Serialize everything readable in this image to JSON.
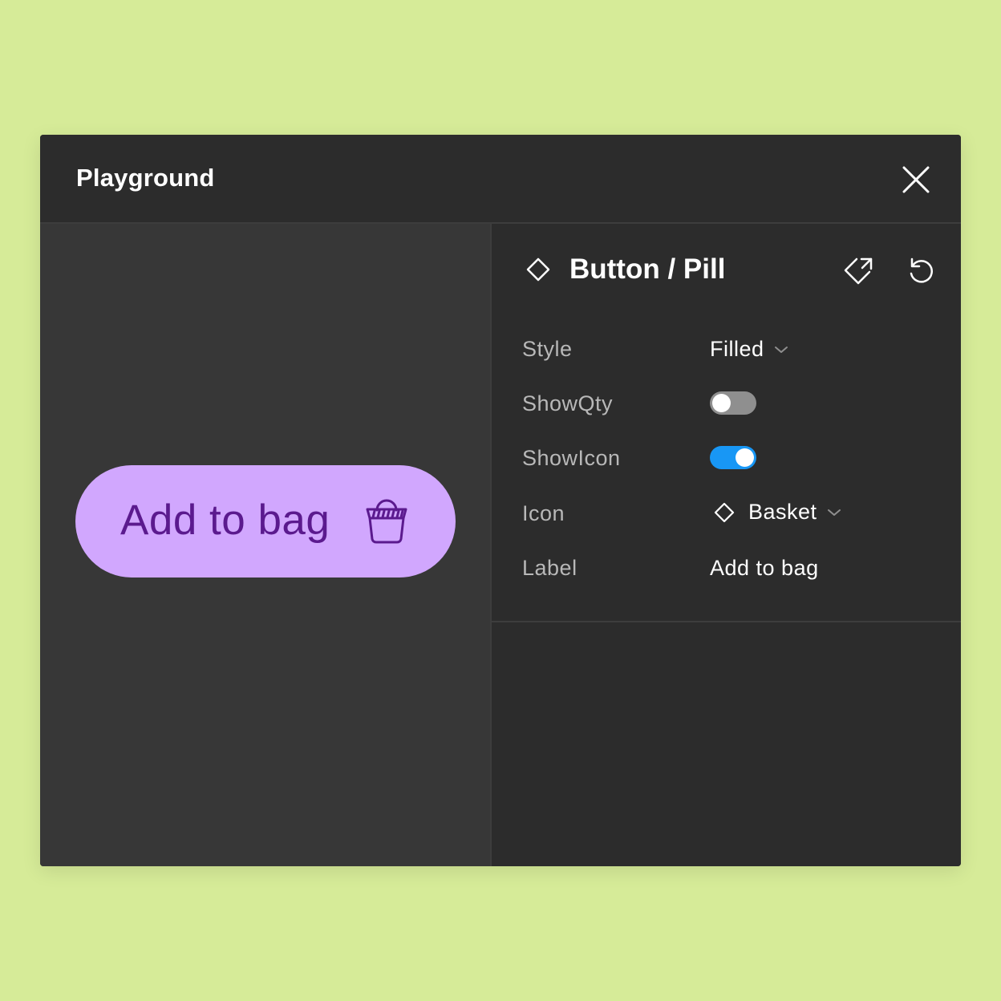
{
  "window": {
    "title": "Playground"
  },
  "preview": {
    "button_label": "Add to bag",
    "button_icon": "basket-icon",
    "button_color": "#d1a7fe",
    "button_text_color": "#5b1a8e"
  },
  "panel": {
    "component_name": "Button / Pill",
    "properties": [
      {
        "label": "Style",
        "value": "Filled"
      },
      {
        "label": "ShowQty",
        "value": false
      },
      {
        "label": "ShowIcon",
        "value": true
      },
      {
        "label": "Icon",
        "value": "Basket"
      },
      {
        "label": "Label",
        "value": "Add to bag"
      }
    ]
  },
  "colors": {
    "page_background": "#d6eb98",
    "toggle_on": "#1897f5",
    "toggle_off": "#8f8f8f"
  }
}
